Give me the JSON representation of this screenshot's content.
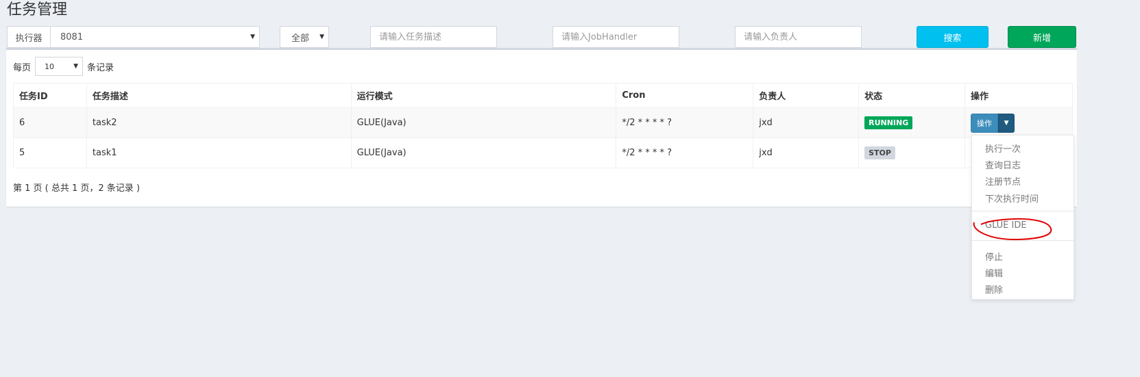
{
  "page": {
    "title": "任务管理"
  },
  "filters": {
    "executor_label": "执行器",
    "executor_value": "8081",
    "status_value": "全部",
    "desc_placeholder": "请输入任务描述",
    "handler_placeholder": "请输入JobHandler",
    "author_placeholder": "请输入负责人",
    "search_label": "搜索",
    "add_label": "新增"
  },
  "pagesize": {
    "prefix": "每页",
    "value": "10",
    "suffix": "条记录"
  },
  "table": {
    "headers": [
      "任务ID",
      "任务描述",
      "运行模式",
      "Cron",
      "负责人",
      "状态",
      "操作"
    ],
    "rows": [
      {
        "id": "6",
        "desc": "task2",
        "mode": "GLUE(Java)",
        "cron": "*/2 * * * * ?",
        "author": "jxd",
        "status": "RUNNING"
      },
      {
        "id": "5",
        "desc": "task1",
        "mode": "GLUE(Java)",
        "cron": "*/2 * * * * ?",
        "author": "jxd",
        "status": "STOP"
      }
    ],
    "op_label": "操作"
  },
  "pager": {
    "info": "第 1 页 ( 总共 1 页，2 条记录 )"
  },
  "dropdown": {
    "items": [
      "执行一次",
      "查询日志",
      "注册节点",
      "下次执行时间",
      "GLUE IDE",
      "停止",
      "编辑",
      "删除"
    ]
  },
  "colors": {
    "running": "#00a65a",
    "stop": "#d2d6de",
    "primary": "#3c8dbc",
    "search": "#00c0ef",
    "add": "#00a65a",
    "annotation": "#e00000"
  }
}
